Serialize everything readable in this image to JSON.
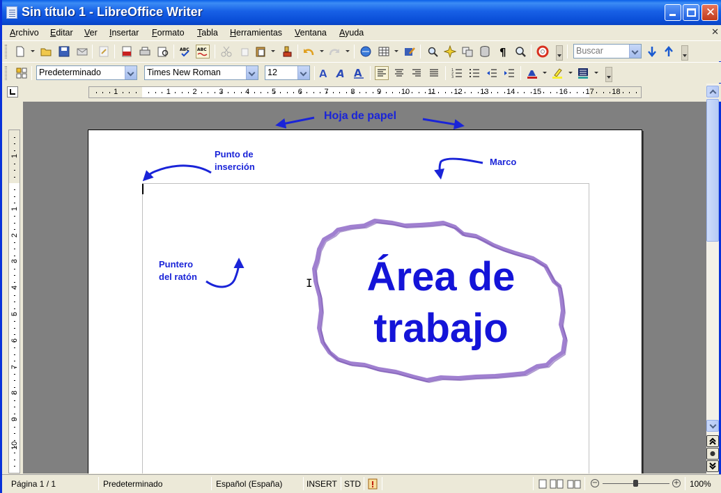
{
  "window": {
    "title": "Sin título 1 - LibreOffice Writer"
  },
  "menu": [
    "Archivo",
    "Editar",
    "Ver",
    "Insertar",
    "Formato",
    "Tabla",
    "Herramientas",
    "Ventana",
    "Ayuda"
  ],
  "standard_toolbar": {
    "search": {
      "placeholder": "Buscar"
    }
  },
  "format_toolbar": {
    "paragraph_style": "Predeterminado",
    "font_name": "Times New Roman",
    "font_size": "12"
  },
  "ruler": {
    "horizontal_numbers": [
      "1",
      "1",
      "2",
      "3",
      "4",
      "5",
      "6",
      "7",
      "8",
      "9",
      "10",
      "11",
      "12",
      "13",
      "14",
      "15",
      "16",
      "17",
      "18"
    ],
    "vertical_numbers": [
      "1",
      "1",
      "2",
      "3",
      "4",
      "5",
      "6",
      "7",
      "8",
      "9",
      "10"
    ]
  },
  "annotations": {
    "hoja": "Hoja de papel",
    "punto_1": "Punto de",
    "punto_2": "inserción",
    "marco": "Marco",
    "puntero_1": "Puntero",
    "puntero_2": "del ratón",
    "area_1": "Área de",
    "area_2": "trabajo"
  },
  "statusbar": {
    "page": "Página  1 / 1",
    "style": "Predeterminado",
    "language": "Español (España)",
    "mode": "INSERT",
    "selection": "STD",
    "zoom": "100%"
  },
  "colors": {
    "annotation_blue": "#1a24d8",
    "cloud_border": "#9a78c8",
    "title_bar": "#0a5fe8"
  }
}
